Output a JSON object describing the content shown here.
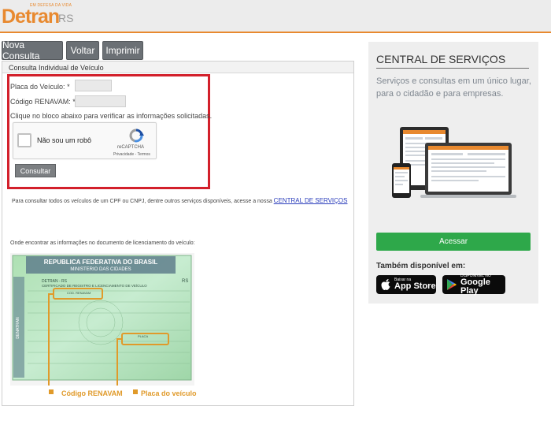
{
  "header": {
    "logo_main": "Detran",
    "logo_suffix": "RS",
    "logo_tagline": "EM DEFESA DA VIDA",
    "accent_color": "#e8892f"
  },
  "toolbar": {
    "nova_consulta": "Nova Consulta",
    "voltar": "Voltar",
    "imprimir": "Imprimir"
  },
  "form": {
    "section_title": "Consulta Individual de Veículo",
    "placa_label": "Placa do Veículo:",
    "renavam_label": "Código RENAVAM:",
    "required_mark": "*",
    "placa_value": "",
    "renavam_value": "",
    "instruction": "Clique no bloco abaixo para verificar as informações solicitadas.",
    "captcha": {
      "label": "Não sou um robô",
      "brand": "reCAPTCHA",
      "links": "Privacidade - Termos"
    },
    "submit_label": "Consultar",
    "highlight_color": "#d3202b"
  },
  "info": {
    "text": "Para consultar todos os veículos de um CPF ou CNPJ, dentre outros serviços disponíveis, acesse a nossa",
    "link_text": "CENTRAL DE SERVIÇOS",
    "document_caption": "Onde encontrar as informações no documento de licenciamento do veículo:"
  },
  "document_image": {
    "header_line1": "REPUBLICA FEDERATIVA DO BRASIL",
    "header_line2": "MINISTERIO DAS CIDADES",
    "subheader_line1": "DETRAN - RS",
    "subheader_line2": "CERTIFICADO DE REGISTRO E LICENCIAMENTO DE VEÍCULO",
    "state": "RS",
    "side_text": "DENATRAN",
    "field_renavam": "COD. RENAVAM",
    "field_placa": "PLACA",
    "label_renavam": "Código RENAVAM",
    "label_placa": "Placa do veículo"
  },
  "sidebar": {
    "title": "CENTRAL DE SERVIÇOS",
    "description": "Serviços e consultas em um único lugar, para o cidadão e para empresas.",
    "cta_label": "Acessar",
    "cta_color": "#2ea84a",
    "available_label": "Também disponível em:",
    "app_store_small": "Baixar na",
    "app_store_big": "App Store",
    "google_play_small": "DISPONÍVEL NO",
    "google_play_big": "Google Play"
  }
}
